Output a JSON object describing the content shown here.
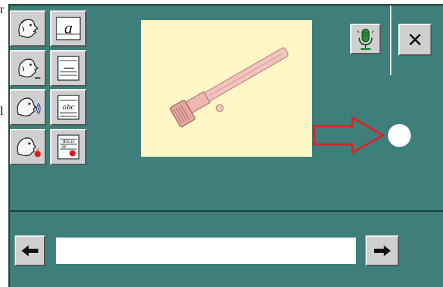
{
  "edge": {
    "top_char": "r",
    "mid_char": "l"
  },
  "toolbar": {
    "close_label": "✕",
    "mic_icon": "microphone-icon"
  },
  "mode_buttons": [
    {
      "icon": "face-speak-icon"
    },
    {
      "icon": "letter-a-icon",
      "glyph": "a"
    },
    {
      "icon": "face-blank-icon"
    },
    {
      "icon": "fill-in-icon",
      "text": "fill in"
    },
    {
      "icon": "face-sound-icon"
    },
    {
      "icon": "abc-icon",
      "text": "abc"
    },
    {
      "icon": "face-apple-icon"
    },
    {
      "icon": "this-is-an-icon",
      "text": "this is an"
    }
  ],
  "picture": {
    "icon": "razor-icon"
  },
  "answer": {
    "value": "",
    "placeholder": ""
  },
  "colors": {
    "panel": "#3e7f7b",
    "arrow": "#e02020",
    "tile": "#cfcfcf",
    "picture_bg": "#fff8c6"
  }
}
